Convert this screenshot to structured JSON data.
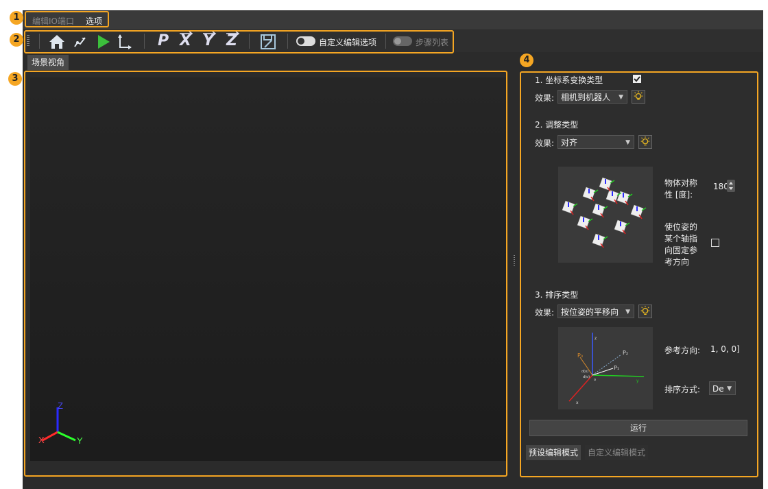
{
  "menubar": {
    "items": [
      "编辑IO端口",
      "选项"
    ]
  },
  "badges": [
    "1",
    "2",
    "3",
    "4"
  ],
  "toolbar": {
    "letters": [
      "P",
      "X",
      "Y",
      "Z"
    ],
    "toggle_custom_label": "自定义编辑选项",
    "toggle_steps_label": "步骤列表",
    "colors": {
      "play": "#3cbf3c",
      "accent": "#f5a623"
    }
  },
  "scene": {
    "tab_label": "场景视角",
    "axis_labels": {
      "z": "Z",
      "x": "X",
      "y": "Y"
    }
  },
  "panel": {
    "section1": {
      "title": "1. 坐标系变换类型",
      "effect_label": "效果:",
      "effect_value": "相机到机器人",
      "checked": true
    },
    "section2": {
      "title": "2. 调整类型",
      "effect_label": "效果:",
      "effect_value": "对齐",
      "symmetry_label_1": "物体对称",
      "symmetry_label_2": "性 [度]:",
      "symmetry_value": "180",
      "fix_axis_label": [
        "使位姿的",
        "某个轴指",
        "向固定参",
        "考方向"
      ],
      "fix_axis_checked": false
    },
    "section3": {
      "title": "3. 排序类型",
      "effect_label": "效果:",
      "effect_value": "按位姿的平移向",
      "ref_dir_label": "参考方向:",
      "ref_dir_value": "1, 0, 0]",
      "sort_label": "排序方式:",
      "sort_value": "De",
      "diagram_labels": {
        "z": "z",
        "y": "y",
        "x": "x",
        "p0": "P₀",
        "p1": "P₁",
        "p2": "P₂",
        "o": "o",
        "d0": "d(o)",
        "d1": "d(o)"
      }
    },
    "run_label": "运行",
    "tabs": [
      "预设编辑模式",
      "自定义编辑模式"
    ]
  }
}
